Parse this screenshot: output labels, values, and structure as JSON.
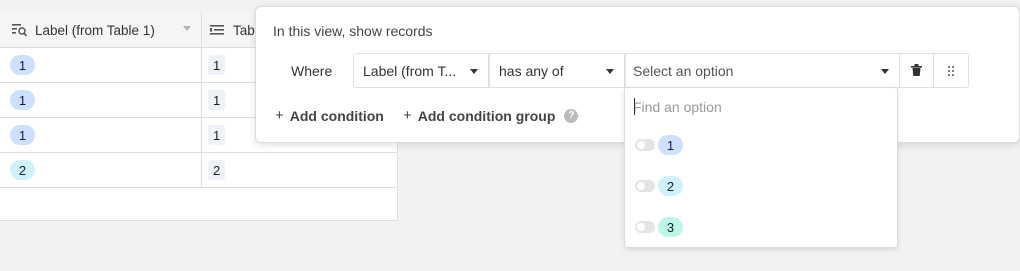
{
  "grid": {
    "columns": [
      {
        "label": "Label (from Table 1)",
        "icon": "lookup-icon"
      },
      {
        "label": "Tab",
        "icon": "rollup-icon"
      }
    ],
    "rows": [
      {
        "label": "1",
        "value": "1",
        "color": "#cfdfff"
      },
      {
        "label": "1",
        "value": "1",
        "color": "#cfdfff"
      },
      {
        "label": "1",
        "value": "1",
        "color": "#cfdfff"
      },
      {
        "label": "2",
        "value": "2",
        "color": "#d0f0fd"
      }
    ]
  },
  "filter": {
    "title": "In this view, show records",
    "where_label": "Where",
    "field": "Label (from T...",
    "operator": "has any of",
    "value_placeholder": "Select an option",
    "add_condition": "Add condition",
    "add_condition_group": "Add condition group"
  },
  "dropdown": {
    "search_placeholder": "Find an option",
    "options": [
      {
        "label": "1",
        "color": "#cfdfff"
      },
      {
        "label": "2",
        "color": "#d0f0fd"
      },
      {
        "label": "3",
        "color": "#c2f5e9"
      }
    ]
  }
}
